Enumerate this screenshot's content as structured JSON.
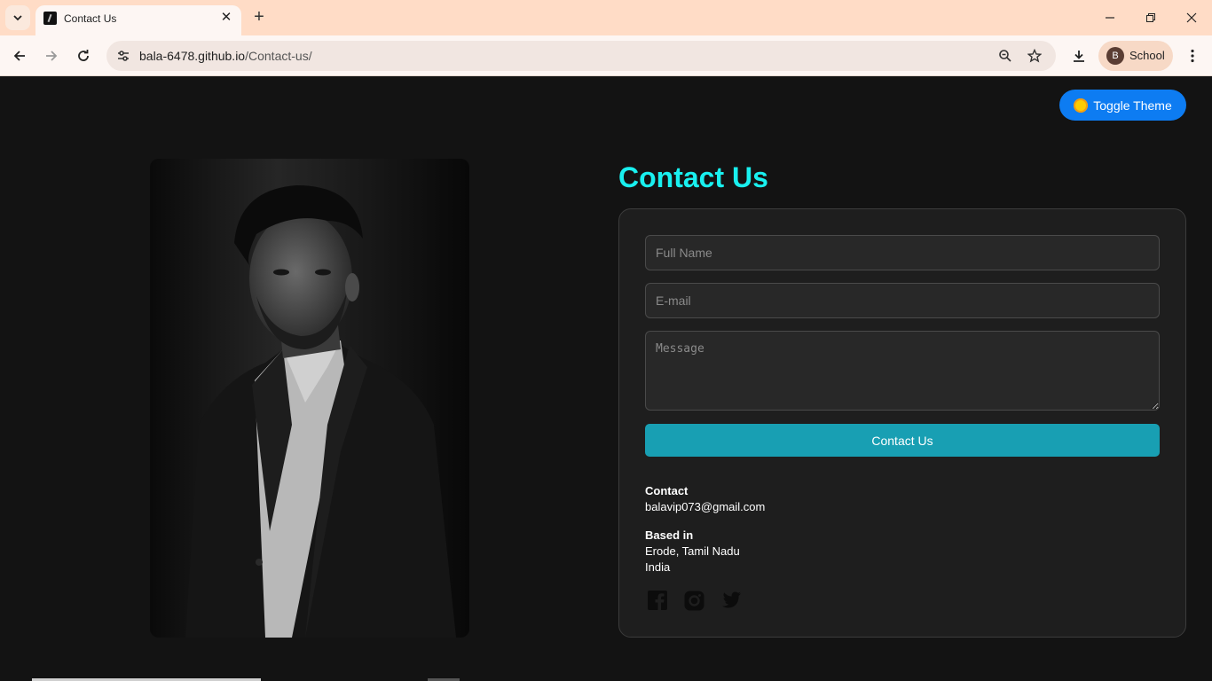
{
  "browser": {
    "tab_title": "Contact Us",
    "url_host": "bala-6478.github.io",
    "url_path": "/Contact-us/",
    "profile_initial": "B",
    "profile_name": "School"
  },
  "page": {
    "theme_button": "Toggle Theme",
    "title": "Contact Us",
    "form": {
      "name_placeholder": "Full Name",
      "email_placeholder": "E-mail",
      "message_placeholder": "Message",
      "submit_label": "Contact Us"
    },
    "contact": {
      "label": "Contact",
      "email": "balavip073@gmail.com"
    },
    "based": {
      "label": "Based in",
      "city": "Erode, Tamil Nadu",
      "country": "India"
    },
    "social_icons": [
      "facebook-icon",
      "instagram-icon",
      "twitter-icon"
    ]
  },
  "colors": {
    "accent_title": "#19f0ef",
    "submit": "#189fb3",
    "theme_button": "#0d7cf2",
    "background": "#131313"
  }
}
